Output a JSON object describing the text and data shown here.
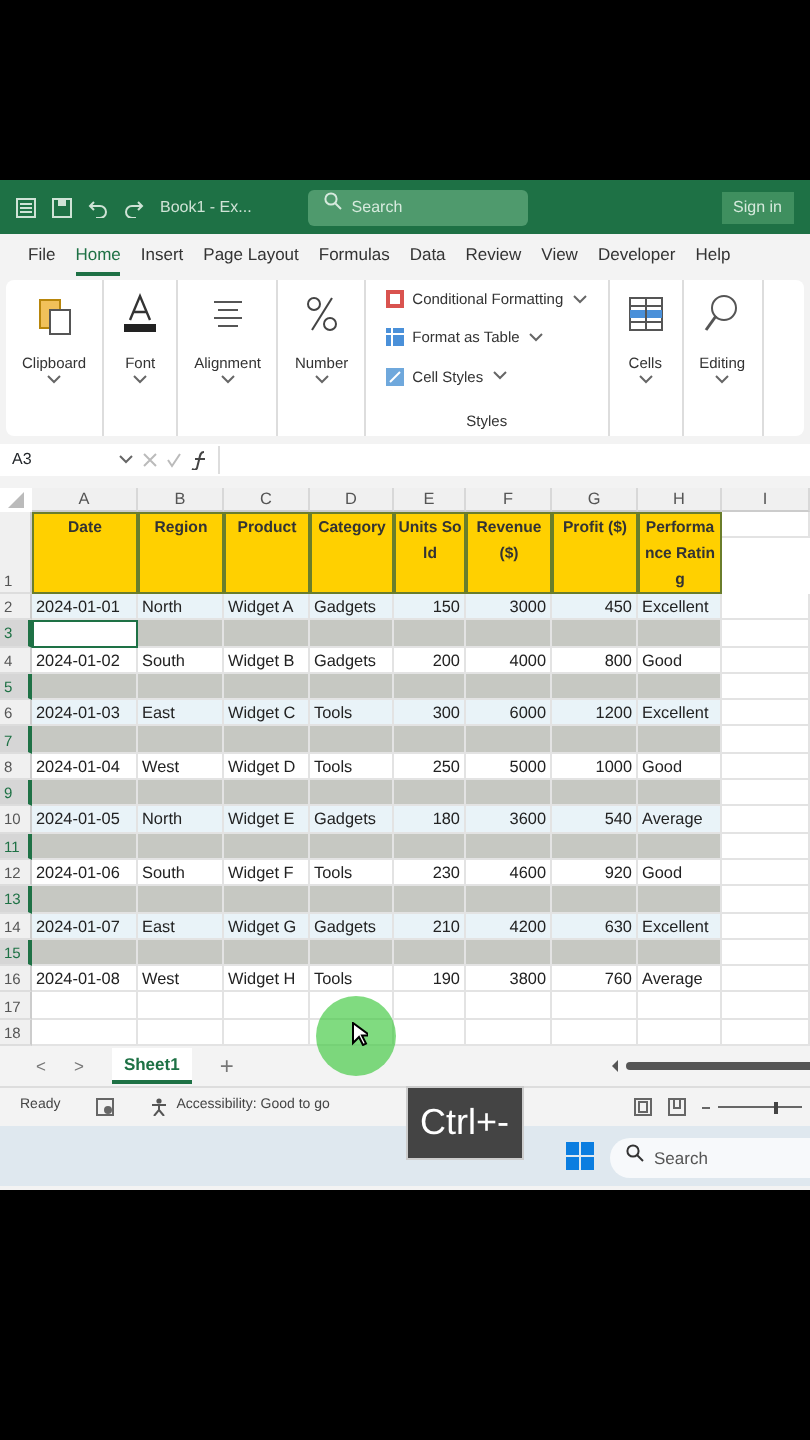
{
  "title_bar": {
    "document": "Book1 - Ex...",
    "search_placeholder": "Search",
    "sign_in": "Sign in"
  },
  "menu_tabs": [
    {
      "label": "File",
      "selected": false
    },
    {
      "label": "Home",
      "selected": true
    },
    {
      "label": "Insert",
      "selected": false
    },
    {
      "label": "Page Layout",
      "selected": false
    },
    {
      "label": "Formulas",
      "selected": false
    },
    {
      "label": "Data",
      "selected": false
    },
    {
      "label": "Review",
      "selected": false
    },
    {
      "label": "View",
      "selected": false
    },
    {
      "label": "Developer",
      "selected": false
    },
    {
      "label": "Help",
      "selected": false
    }
  ],
  "ribbon": [
    {
      "kind": "big",
      "label": "Clipboard"
    },
    {
      "kind": "big",
      "label": "Font"
    },
    {
      "kind": "big",
      "label": "Alignment"
    },
    {
      "kind": "big",
      "label": "Number"
    },
    {
      "kind": "list",
      "label": "Styles",
      "items": [
        "Conditional Formatting",
        "Format as Table",
        "Cell Styles"
      ]
    },
    {
      "kind": "big",
      "label": "Cells"
    },
    {
      "kind": "big",
      "label": "Editing"
    }
  ],
  "formula_bar": {
    "name_box": "A3"
  },
  "sheet": {
    "columns": [
      "A",
      "B",
      "C",
      "D",
      "E",
      "F",
      "G",
      "H",
      "I"
    ],
    "headers": [
      "Date",
      "Region",
      "Product",
      "Category",
      "Units Sold",
      "Revenue ($)",
      "Profit ($)",
      "Performance Rating"
    ],
    "header_row": "1",
    "rows": [
      {
        "number": "2",
        "kind": "data",
        "shaded": true,
        "cells": [
          "2024-01-01",
          "North",
          "Widget A",
          "Gadgets",
          "150",
          "3000",
          "450",
          "Excellent"
        ]
      },
      {
        "number": "3",
        "kind": "blank",
        "selected": true,
        "active": true
      },
      {
        "number": "4",
        "kind": "data",
        "shaded": false,
        "cells": [
          "2024-01-02",
          "South",
          "Widget B",
          "Gadgets",
          "200",
          "4000",
          "800",
          "Good"
        ]
      },
      {
        "number": "5",
        "kind": "blank",
        "selected": true,
        "active": false
      },
      {
        "number": "6",
        "kind": "data",
        "shaded": true,
        "cells": [
          "2024-01-03",
          "East",
          "Widget C",
          "Tools",
          "300",
          "6000",
          "1200",
          "Excellent"
        ]
      },
      {
        "number": "7",
        "kind": "blank",
        "selected": true,
        "active": false
      },
      {
        "number": "8",
        "kind": "data",
        "shaded": false,
        "cells": [
          "2024-01-04",
          "West",
          "Widget D",
          "Tools",
          "250",
          "5000",
          "1000",
          "Good"
        ]
      },
      {
        "number": "9",
        "kind": "blank",
        "selected": true,
        "active": false
      },
      {
        "number": "10",
        "kind": "data",
        "shaded": true,
        "cells": [
          "2024-01-05",
          "North",
          "Widget E",
          "Gadgets",
          "180",
          "3600",
          "540",
          "Average"
        ]
      },
      {
        "number": "11",
        "kind": "blank",
        "selected": true,
        "active": false
      },
      {
        "number": "12",
        "kind": "data",
        "shaded": false,
        "cells": [
          "2024-01-06",
          "South",
          "Widget F",
          "Tools",
          "230",
          "4600",
          "920",
          "Good"
        ]
      },
      {
        "number": "13",
        "kind": "blank",
        "selected": true,
        "active": false
      },
      {
        "number": "14",
        "kind": "data",
        "shaded": true,
        "cells": [
          "2024-01-07",
          "East",
          "Widget G",
          "Gadgets",
          "210",
          "4200",
          "630",
          "Excellent"
        ]
      },
      {
        "number": "15",
        "kind": "blank",
        "selected": true,
        "active": false
      },
      {
        "number": "16",
        "kind": "data",
        "shaded": false,
        "cells": [
          "2024-01-08",
          "West",
          "Widget H",
          "Tools",
          "190",
          "3800",
          "760",
          "Average"
        ]
      },
      {
        "number": "17",
        "kind": "empty"
      },
      {
        "number": "18",
        "kind": "empty"
      }
    ]
  },
  "sheet_nav": {
    "previous": "<",
    "next": ">",
    "add": "+"
  },
  "sheet_tabs": [
    {
      "label": "Sheet1",
      "selected": true
    }
  ],
  "status_bar": {
    "ready": "Ready",
    "accessibility": "Accessibility: Good to go",
    "zoom_slider": {
      "level": 0.7
    }
  },
  "taskbar": {
    "search_placeholder": "Search"
  },
  "key_overlay": "Ctrl+-"
}
